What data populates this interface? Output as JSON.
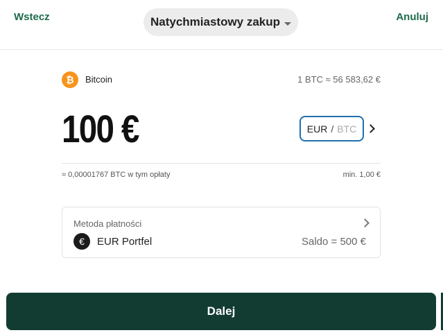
{
  "header": {
    "back_label": "Wstecz",
    "title": "Natychmiastowy zakup",
    "cancel_label": "Anuluj"
  },
  "asset": {
    "icon": "bitcoin-icon",
    "icon_glyph": "₿",
    "name": "Bitcoin",
    "rate": "1 BTC ≈ 56 583,62 €"
  },
  "order": {
    "amount": "100 €",
    "currency_active": "EUR",
    "currency_separator": "/",
    "currency_inactive": "BTC",
    "equivalent": "≈ 0,00001767 BTC w tym opłaty",
    "minimum": "min. 1,00 €"
  },
  "payment": {
    "title": "Metoda płatności",
    "icon": "euro-icon",
    "icon_glyph": "€",
    "wallet": "EUR Portfel",
    "balance": "Saldo = 500 €"
  },
  "footer": {
    "next_label": "Dalej"
  },
  "colors": {
    "accent_green": "#1e6b4c",
    "button_dark": "#123c32",
    "bitcoin_orange": "#f7931a",
    "toggle_border": "#1f6fb0"
  }
}
